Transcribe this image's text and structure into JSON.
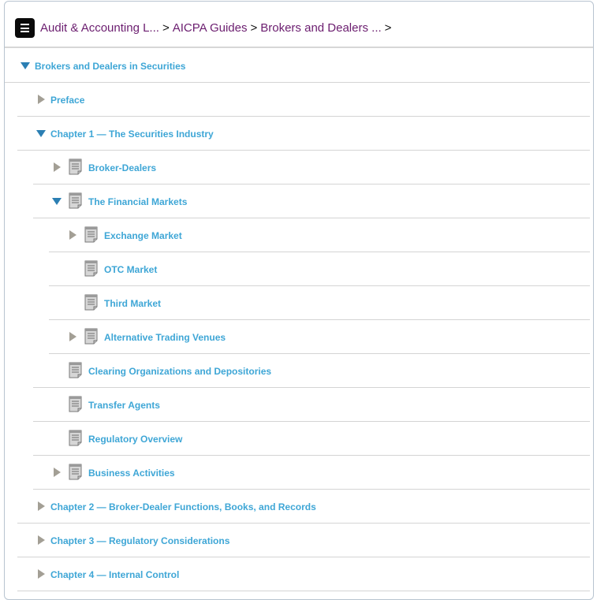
{
  "breadcrumb": {
    "items": [
      "Audit & Accounting L...",
      "AICPA Guides",
      "Brokers and Dealers ..."
    ],
    "separator": ">"
  },
  "tree": {
    "nodes": [
      {
        "label": "Brokers and Dealers in Securities",
        "toggle": "expanded",
        "doc_icon": false
      },
      {
        "label": "Preface",
        "toggle": "collapsed",
        "doc_icon": false
      },
      {
        "label": "Chapter 1 — The Securities Industry",
        "toggle": "expanded",
        "doc_icon": false
      },
      {
        "label": "Broker-Dealers",
        "toggle": "collapsed",
        "doc_icon": true
      },
      {
        "label": "The Financial Markets",
        "toggle": "expanded",
        "doc_icon": true
      },
      {
        "label": "Exchange Market",
        "toggle": "collapsed",
        "doc_icon": true
      },
      {
        "label": "OTC Market",
        "toggle": "none",
        "doc_icon": true
      },
      {
        "label": "Third Market",
        "toggle": "none",
        "doc_icon": true
      },
      {
        "label": "Alternative Trading Venues",
        "toggle": "collapsed",
        "doc_icon": true
      },
      {
        "label": "Clearing Organizations and Depositories",
        "toggle": "none",
        "doc_icon": true
      },
      {
        "label": "Transfer Agents",
        "toggle": "none",
        "doc_icon": true
      },
      {
        "label": "Regulatory Overview",
        "toggle": "none",
        "doc_icon": true
      },
      {
        "label": "Business Activities",
        "toggle": "collapsed",
        "doc_icon": true
      },
      {
        "label": "Chapter 2 — Broker-Dealer Functions, Books, and Records",
        "toggle": "collapsed",
        "doc_icon": false
      },
      {
        "label": "Chapter 3 — Regulatory Considerations",
        "toggle": "collapsed",
        "doc_icon": false
      },
      {
        "label": "Chapter 4 — Internal Control",
        "toggle": "collapsed",
        "doc_icon": false
      }
    ]
  },
  "colors": {
    "link": "#3ea6d6",
    "breadcrumb_link": "#6b1d6f",
    "expanded_arrow": "#2b7fb3",
    "collapsed_arrow": "#a39f95"
  }
}
